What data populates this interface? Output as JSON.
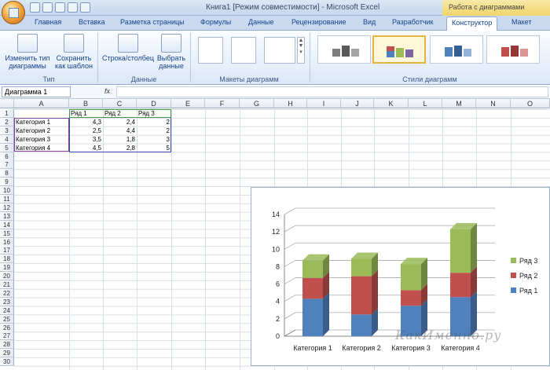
{
  "window": {
    "title": "Книга1  [Режим совместимости] - Microsoft Excel",
    "context_title": "Работа с диаграммами"
  },
  "tabs": [
    "Главная",
    "Вставка",
    "Разметка страницы",
    "Формулы",
    "Данные",
    "Рецензирование",
    "Вид",
    "Разработчик",
    "Конструктор",
    "Макет"
  ],
  "active_tab": "Конструктор",
  "ribbon": {
    "groups": {
      "type": "Тип",
      "data": "Данные",
      "layouts": "Макеты диаграмм",
      "styles": "Стили диаграмм"
    },
    "buttons": {
      "change_type": "Изменить тип диаграммы",
      "save_template": "Сохранить как шаблон",
      "row_col": "Строка/столбец",
      "select_data": "Выбрать данные"
    }
  },
  "formula_bar": {
    "name_box": "Диаграмма 1",
    "fx": "fx",
    "value": ""
  },
  "columns": [
    "A",
    "B",
    "C",
    "D",
    "E",
    "F",
    "G",
    "H",
    "I",
    "J",
    "K",
    "L",
    "M",
    "N",
    "O"
  ],
  "rows": [
    "1",
    "2",
    "3",
    "4",
    "5",
    "6",
    "7",
    "8",
    "9",
    "10",
    "11",
    "12",
    "13",
    "14",
    "15",
    "16",
    "17",
    "18",
    "19",
    "20",
    "21",
    "22",
    "23",
    "24",
    "25",
    "26",
    "27",
    "28",
    "29",
    "30"
  ],
  "sheet": {
    "headers": [
      "Ряд 1",
      "Ряд 2",
      "Ряд 3"
    ],
    "data": [
      {
        "label": "Категория 1",
        "values": [
          "4,3",
          "2,4",
          "2"
        ]
      },
      {
        "label": "Категория 2",
        "values": [
          "2,5",
          "4,4",
          "2"
        ]
      },
      {
        "label": "Категория 3",
        "values": [
          "3,5",
          "1,8",
          "3"
        ]
      },
      {
        "label": "Категория 4",
        "values": [
          "4,5",
          "2,8",
          "5"
        ]
      }
    ]
  },
  "chart_data": {
    "type": "bar",
    "stacked": true,
    "categories": [
      "Категория 1",
      "Категория 2",
      "Категория 3",
      "Категория 4"
    ],
    "series": [
      {
        "name": "Ряд 1",
        "values": [
          4.3,
          2.5,
          3.5,
          4.5
        ],
        "color": "#4f81bd"
      },
      {
        "name": "Ряд 2",
        "values": [
          2.4,
          4.4,
          1.8,
          2.8
        ],
        "color": "#c0504d"
      },
      {
        "name": "Ряд 3",
        "values": [
          2,
          2,
          3,
          5
        ],
        "color": "#9bbb59"
      }
    ],
    "yticks": [
      "0",
      "2",
      "4",
      "6",
      "8",
      "10",
      "12",
      "14"
    ],
    "ylim": [
      0,
      14
    ],
    "legend": "right",
    "grid": true
  },
  "watermark": "КакИменно.ру"
}
